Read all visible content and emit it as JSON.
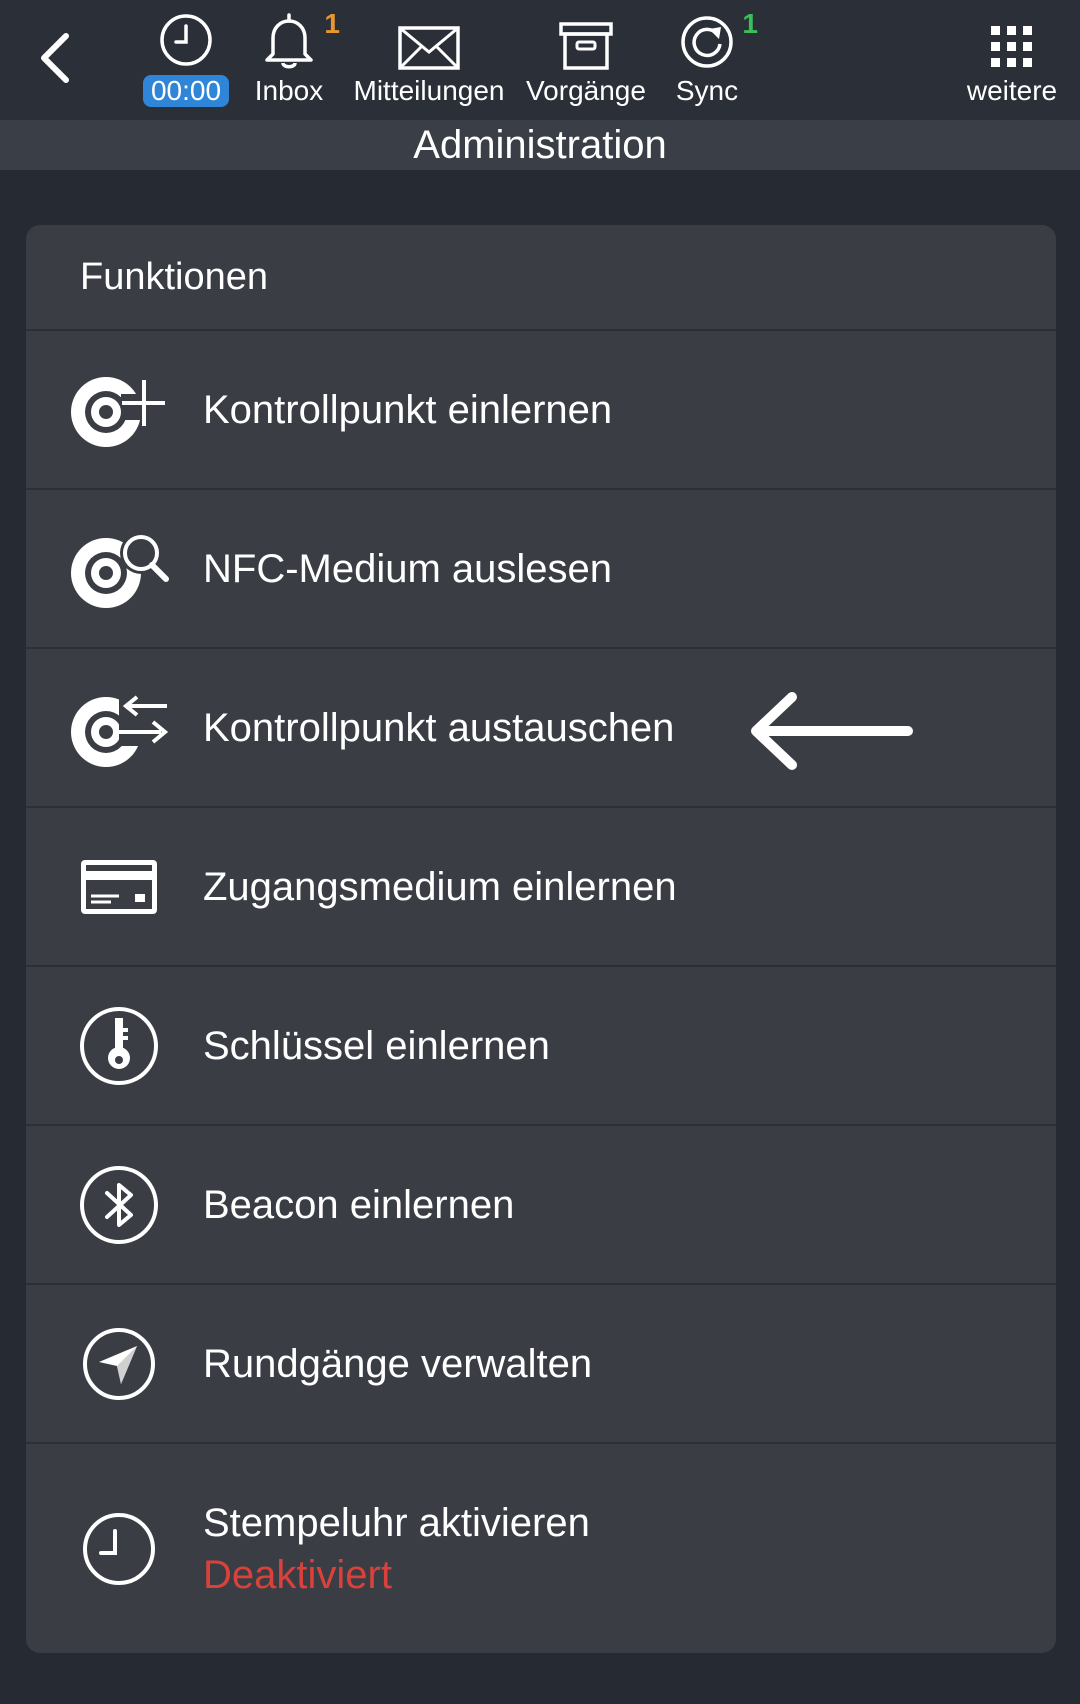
{
  "colors": {
    "background": "#262a33",
    "card": "#3a3d44",
    "timer_pill": "#2f86d8",
    "inbox_badge": "#e8962e",
    "sync_badge": "#3bbf5a",
    "deactivated": "#d9413a"
  },
  "toolbar": {
    "back_icon": "chevron-left-icon",
    "timer": {
      "icon": "clock-icon",
      "value": "00:00"
    },
    "inbox": {
      "icon": "bell-icon",
      "label": "Inbox",
      "badge": "1"
    },
    "messages": {
      "icon": "envelope-icon",
      "label": "Mitteilungen"
    },
    "processes": {
      "icon": "archive-box-icon",
      "label": "Vorgänge"
    },
    "sync": {
      "icon": "sync-icon",
      "label": "Sync",
      "badge": "1"
    },
    "more": {
      "icon": "grid-dots-icon",
      "label": "weitere"
    }
  },
  "page": {
    "title": "Administration"
  },
  "card": {
    "header": "Funktionen",
    "items": [
      {
        "label": "Kontrollpunkt einlernen",
        "icon": "checkpoint-add-icon"
      },
      {
        "label": "NFC-Medium auslesen",
        "icon": "checkpoint-search-icon"
      },
      {
        "label": "Kontrollpunkt austauschen",
        "icon": "checkpoint-swap-icon"
      },
      {
        "label": "Zugangsmedium einlernen",
        "icon": "access-card-icon"
      },
      {
        "label": "Schlüssel einlernen",
        "icon": "key-circle-icon"
      },
      {
        "label": "Beacon einlernen",
        "icon": "bluetooth-circle-icon"
      },
      {
        "label": "Rundgänge verwalten",
        "icon": "navigation-arrow-circle-icon"
      },
      {
        "label": "Stempeluhr aktivieren",
        "icon": "clock-circle-icon",
        "status": "Deaktiviert"
      }
    ]
  }
}
